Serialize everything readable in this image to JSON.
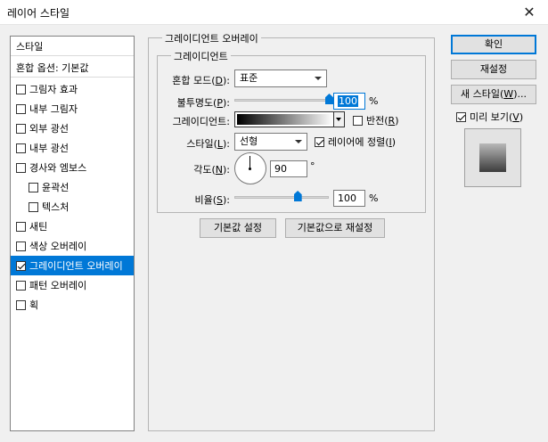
{
  "window": {
    "title": "레이어 스타일",
    "close_glyph": "✕"
  },
  "styles": {
    "header": "스타일",
    "blend_options": "혼합 옵션: 기본값",
    "items": [
      {
        "label": "그림자 효과",
        "checked": false,
        "indent": false
      },
      {
        "label": "내부 그림자",
        "checked": false,
        "indent": false
      },
      {
        "label": "외부 광선",
        "checked": false,
        "indent": false
      },
      {
        "label": "내부 광선",
        "checked": false,
        "indent": false
      },
      {
        "label": "경사와 엠보스",
        "checked": false,
        "indent": false
      },
      {
        "label": "윤곽선",
        "checked": false,
        "indent": true
      },
      {
        "label": "텍스처",
        "checked": false,
        "indent": true
      },
      {
        "label": "새틴",
        "checked": false,
        "indent": false
      },
      {
        "label": "색상 오버레이",
        "checked": false,
        "indent": false
      },
      {
        "label": "그레이디언트 오버레이",
        "checked": true,
        "indent": false,
        "selected": true
      },
      {
        "label": "패턴 오버레이",
        "checked": false,
        "indent": false
      },
      {
        "label": "획",
        "checked": false,
        "indent": false
      }
    ]
  },
  "panel": {
    "outer_legend": "그레이디언트 오버레이",
    "inner_legend": "그레이디언트",
    "blend_mode": {
      "label": "혼합 모드(",
      "key": "D",
      "tail": "):",
      "value": "표준"
    },
    "opacity": {
      "label": "불투명도(",
      "key": "P",
      "tail": "):",
      "value": "100",
      "unit": "%",
      "level": 100
    },
    "gradient": {
      "label": "그레이디언트:"
    },
    "reverse": {
      "label": "반전(",
      "key": "R",
      "tail": ")",
      "checked": false
    },
    "style": {
      "label": "스타일(",
      "key": "L",
      "tail": "):",
      "value": "선형"
    },
    "align": {
      "label": "레이어에 정렬(",
      "key": "I",
      "tail": ")",
      "checked": true
    },
    "angle": {
      "label": "각도(",
      "key": "N",
      "tail": "):",
      "value": "90",
      "unit": "°"
    },
    "scale": {
      "label": "비율(",
      "key": "S",
      "tail": "):",
      "value": "100",
      "unit": "%",
      "level": 100
    },
    "make_default": "기본값 설정",
    "reset_default": "기본값으로 재설정"
  },
  "buttons": {
    "ok": "확인",
    "reset": "재설정",
    "new_style": {
      "label": "새 스타일(",
      "key": "W",
      "tail": ")..."
    },
    "preview": {
      "label": "미리 보기(",
      "key": "V",
      "tail": ")",
      "checked": true
    }
  },
  "colors": {
    "accent": "#0078d7",
    "selected_bg": "#0078d7"
  }
}
